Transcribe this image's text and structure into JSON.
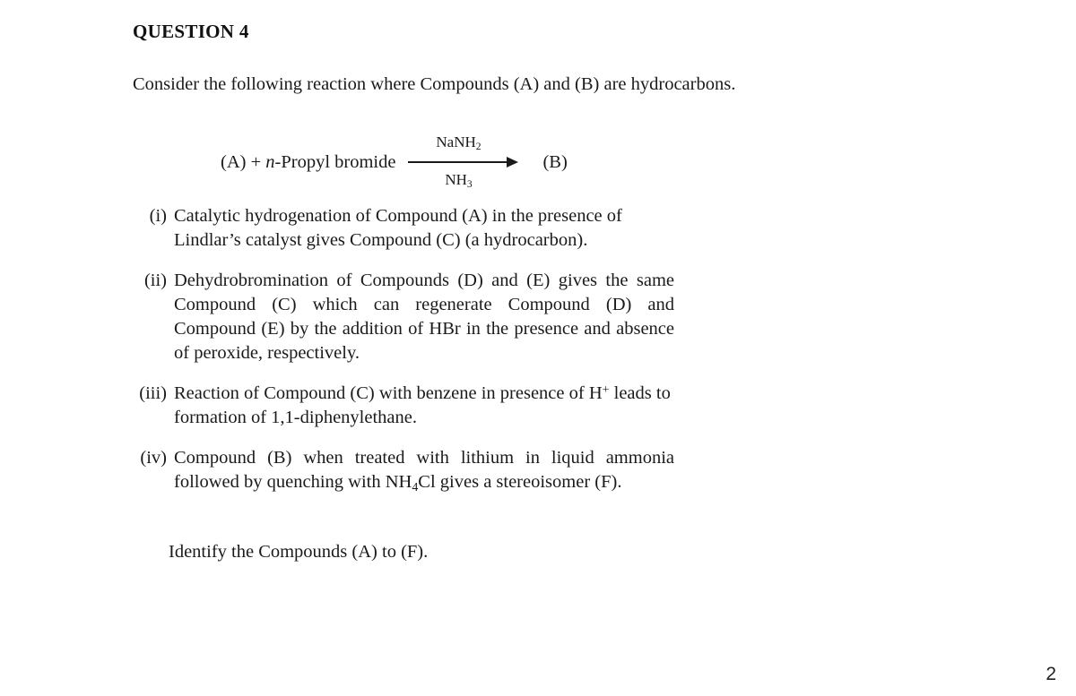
{
  "heading": "QUESTION 4",
  "intro": "Consider the following reaction where Compounds (A) and (B) are hydrocarbons.",
  "reaction": {
    "reactants_prefix": "(A) + ",
    "reactant_italic": "n",
    "reactant_rest": "-Propyl bromide",
    "above_arrow": "NaNH",
    "above_arrow_sub": "2",
    "below_arrow": "NH",
    "below_arrow_sub": "3",
    "product": "(B)"
  },
  "items": [
    {
      "marker": "(i)",
      "text": "Catalytic hydrogenation of Compound (A) in the presence of Lindlar’s catalyst gives Compound (C) (a hydrocarbon)."
    },
    {
      "marker": "(ii)",
      "text": "Dehydrobromination of Compounds (D) and (E) gives the same Compound (C) which can regenerate Compound (D) and Compound (E) by the addition of HBr in the presence and absence of peroxide, respectively."
    },
    {
      "marker": "(iii)",
      "text_part1": "Reaction of Compound (C) with benzene in presence of H",
      "superscript": "+",
      "text_part2": " leads to formation of 1,1-diphenylethane."
    },
    {
      "marker": "(iv)",
      "text_part1": "Compound (B) when treated with lithium in liquid ammonia followed by quenching with NH",
      "subscript": "4",
      "text_part2": "Cl gives a stereoisomer (F)."
    }
  ],
  "closing": "Identify the Compounds (A) to (F).",
  "page_number": "2"
}
